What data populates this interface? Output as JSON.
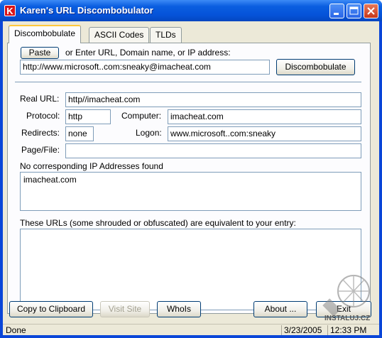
{
  "window": {
    "title": "Karen's URL Discombobulator",
    "icon_letter": "K"
  },
  "tabs": [
    "Discombobulate",
    "ASCII Codes",
    "TLDs"
  ],
  "input_section": {
    "paste_label": "Paste",
    "prompt": "or Enter URL, Domain name, or IP address:",
    "url_value": "http://www.microsoft..com:sneaky@imacheat.com",
    "discombobulate_label": "Discombobulate"
  },
  "results": {
    "real_url_label": "Real URL:",
    "real_url_value": "http//imacheat.com",
    "protocol_label": "Protocol:",
    "protocol_value": "http",
    "computer_label": "Computer:",
    "computer_value": "imacheat.com",
    "redirects_label": "Redirects:",
    "redirects_value": "none",
    "logon_label": "Logon:",
    "logon_value": "www.microsoft..com:sneaky",
    "pagefile_label": "Page/File:",
    "pagefile_value": "",
    "ip_heading": "No corresponding IP Addresses found",
    "ip_list_value": "imacheat.com",
    "equiv_heading": "These URLs (some shrouded or obfuscated) are equivalent to your entry:",
    "equiv_list_value": ""
  },
  "bottom_buttons": {
    "copy": "Copy to Clipboard",
    "visit": "Visit Site",
    "whois": "WhoIs",
    "about": "About ...",
    "exit": "Exit"
  },
  "statusbar": {
    "status": "Done",
    "date": "3/23/2005",
    "time": "12:33 PM"
  },
  "watermark_text": "INSTALUJ.CZ"
}
